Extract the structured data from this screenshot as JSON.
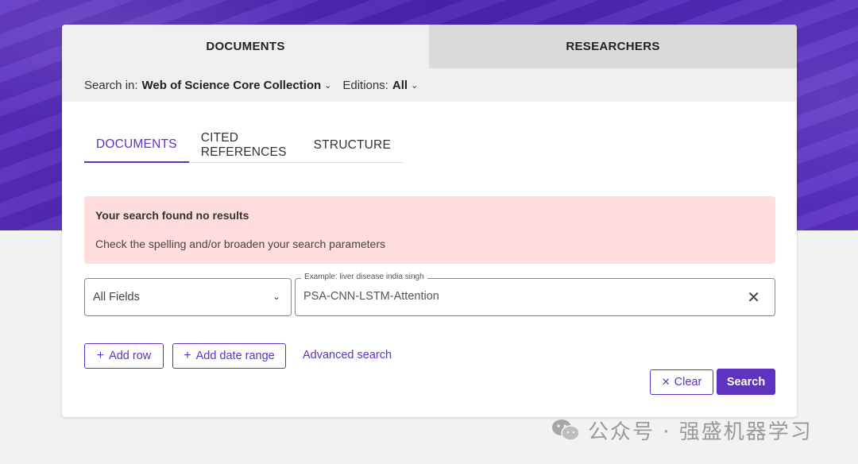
{
  "top_tabs": [
    {
      "label": "DOCUMENTS",
      "active": true
    },
    {
      "label": "RESEARCHERS",
      "active": false
    }
  ],
  "search_in": {
    "label": "Search in:",
    "collection": "Web of Science Core Collection",
    "editions_label": "Editions:",
    "editions_value": "All"
  },
  "sub_tabs": [
    {
      "label": "DOCUMENTS",
      "active": true
    },
    {
      "label": "CITED REFERENCES",
      "active": false
    },
    {
      "label": "STRUCTURE",
      "active": false
    }
  ],
  "alert": {
    "title": "Your search found no results",
    "text": "Check the spelling and/or broaden your search parameters"
  },
  "query_row": {
    "field": "All Fields",
    "legend": "Example: liver disease india singh",
    "value": "PSA-CNN-LSTM-Attention"
  },
  "actions": {
    "add_row": "Add row",
    "add_date_range": "Add date range",
    "advanced_search": "Advanced search",
    "clear": "Clear",
    "search": "Search"
  },
  "watermark": {
    "text": "公众号 · 强盛机器学习",
    "icon": "wechat-icon"
  },
  "colors": {
    "accent": "#5e33bf",
    "alert_bg": "#ffdddd",
    "hero": "#4b24b0"
  }
}
